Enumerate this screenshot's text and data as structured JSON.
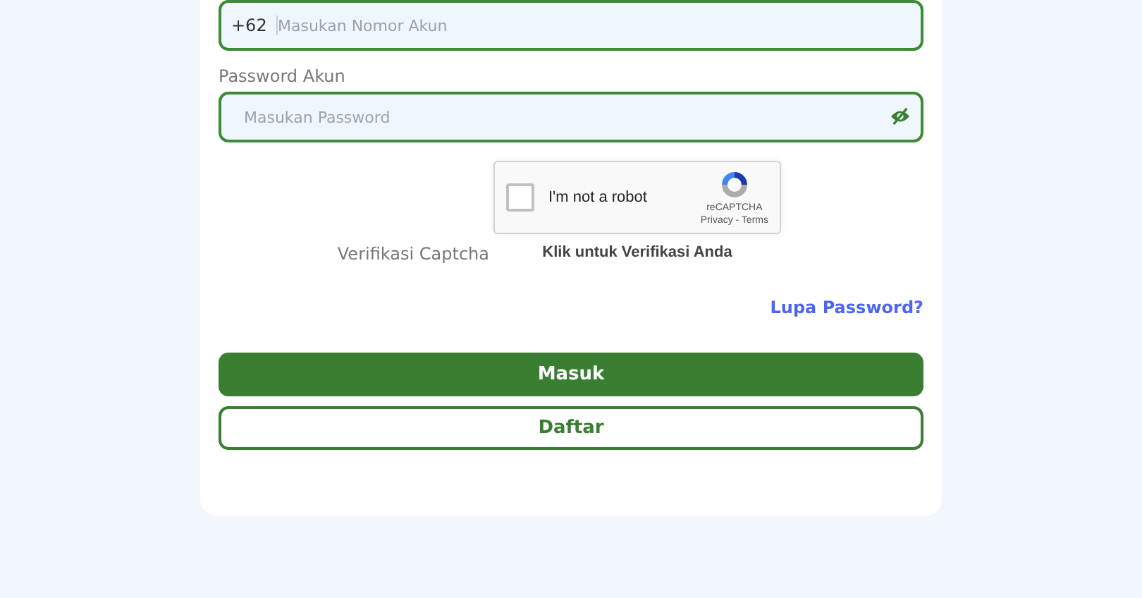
{
  "phone_field": {
    "prefix": "+62",
    "placeholder": "Masukan Nomor Akun"
  },
  "password_field": {
    "label": "Password Akun",
    "placeholder": "Masukan Password"
  },
  "captcha": {
    "label": "Verifikasi Captcha",
    "checked": false,
    "checkbox_label": "I'm not a robot",
    "brand": "reCAPTCHA",
    "links": "Privacy - Terms",
    "hint": "Klik untuk Verifikasi Anda"
  },
  "forgot_link": "Lupa Password?",
  "buttons": [
    {
      "label": "Masuk",
      "kind": "primary"
    },
    {
      "label": "Daftar",
      "kind": "outline"
    }
  ]
}
